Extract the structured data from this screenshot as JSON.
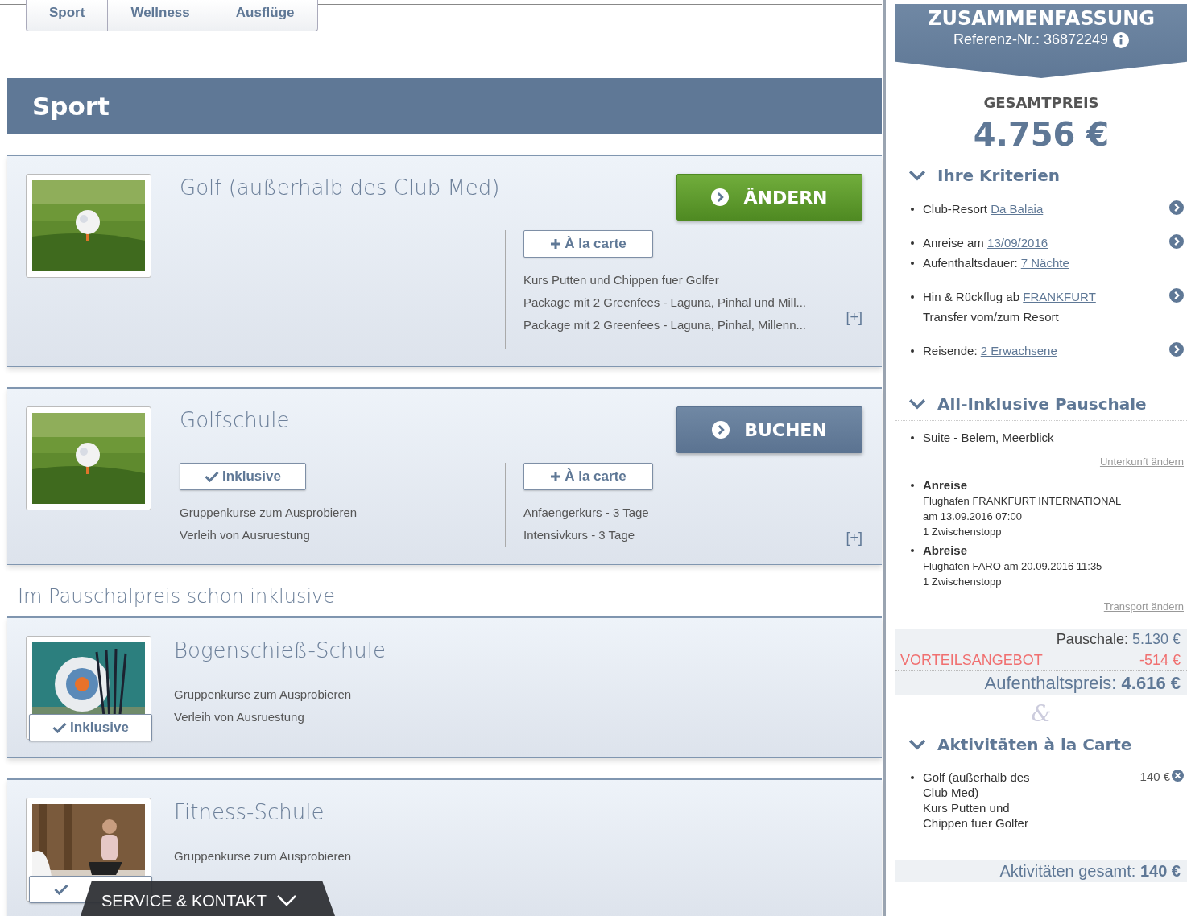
{
  "category_tabs": [
    {
      "label": "Sport"
    },
    {
      "label": "Wellness"
    },
    {
      "label": "Ausflüge"
    }
  ],
  "section_title": "Sport",
  "activities": [
    {
      "title": "Golf (außerhalb des Club Med)",
      "image": {
        "kind": "picture"
      },
      "action": {
        "kind": "change",
        "label": "ÄNDERN"
      },
      "alacarte": {
        "label": "À la carte",
        "items": [
          "Kurs Putten und Chippen fuer Golfer",
          "Package mit 2 Greenfees - Laguna, Pinhal und Mill...",
          "Package mit 2 Greenfees - Laguna, Pinhal, Millenn..."
        ]
      },
      "expand": "[+]"
    },
    {
      "title": "Golfschule",
      "image": {
        "kind": "picture"
      },
      "action": {
        "kind": "book",
        "label": "BUCHEN"
      },
      "included": {
        "label": "Inklusive",
        "items": [
          "Gruppenkurse zum Ausprobieren",
          "Verleih von Ausruestung"
        ]
      },
      "alacarte": {
        "label": "À la carte",
        "items": [
          "Anfaengerkurs - 3 Tage",
          "Intensivkurs - 3 Tage"
        ]
      },
      "expand": "[+]"
    }
  ],
  "included_heading": "Im Pauschalpreis schon inklusive",
  "included_activities": [
    {
      "title": "Bogenschieß-Schule",
      "image": {
        "kind": "picture"
      },
      "badge": "Inklusive",
      "items": [
        "Gruppenkurse zum Ausprobieren",
        "Verleih von Ausruestung"
      ]
    },
    {
      "title": "Fitness-Schule",
      "image": {
        "kind": "picture"
      },
      "items": [
        "Gruppenkurse zum Ausprobieren"
      ]
    }
  ],
  "footer_bar": {
    "label": "SERVICE & KONTAKT"
  },
  "summary": {
    "title": "ZUSAMMENFASSUNG",
    "reference": "Referenz-Nr.: 36872249",
    "total_label": "GESAMTPREIS",
    "total": "4.756 €",
    "criteria": {
      "heading": "Ihre Kriterien",
      "expanded": true,
      "groups": [
        {
          "lines": [
            {
              "bullet": true,
              "text": "Club-Resort ",
              "link": "Da Balaia"
            }
          ]
        },
        {
          "lines": [
            {
              "bullet": true,
              "text": "Anreise am ",
              "link": "13/09/2016"
            },
            {
              "bullet": true,
              "text": "Aufenthaltsdauer: ",
              "link": "7 Nächte"
            }
          ]
        },
        {
          "lines": [
            {
              "bullet": true,
              "text": "Hin & Rückflug ab ",
              "link": "FRANKFURT"
            },
            {
              "bullet": false,
              "text": "Transfer vom/zum Resort"
            }
          ]
        },
        {
          "lines": [
            {
              "bullet": true,
              "text": "Reisende: ",
              "link": "2 Erwachsene"
            }
          ]
        }
      ]
    },
    "package": {
      "heading": "All-Inklusive Pauschale",
      "expanded": true,
      "room": "Suite - Belem, Meerblick",
      "room_link": "Unterkunft ändern",
      "flights": [
        {
          "label": "Anreise",
          "lines": [
            "Flughafen FRANKFURT INTERNATIONAL",
            "am 13.09.2016 07:00",
            "1 Zwischenstopp"
          ]
        },
        {
          "label": "Abreise",
          "lines": [
            "Flughafen FARO am 20.09.2016 11:35",
            "1 Zwischenstopp"
          ]
        }
      ],
      "transport_link": "Transport ändern",
      "package_price": {
        "label": "Pauschale:",
        "value": "5.130 €"
      },
      "discount": {
        "label": "VORTEILSANGEBOT",
        "value": "-514 €"
      },
      "stay_price": {
        "label": "Aufenthaltspreis:",
        "value": "4.616 €"
      }
    },
    "ampersand": "&",
    "extras": {
      "heading": "Aktivitäten à la Carte",
      "expanded": true,
      "items": [
        {
          "name": "Golf (außerhalb des Club Med)",
          "detail": "Kurs Putten und Chippen fuer Golfer",
          "price": "140 €"
        }
      ],
      "total": {
        "label": "Aktivitäten gesamt:",
        "value": "140 €"
      }
    }
  }
}
